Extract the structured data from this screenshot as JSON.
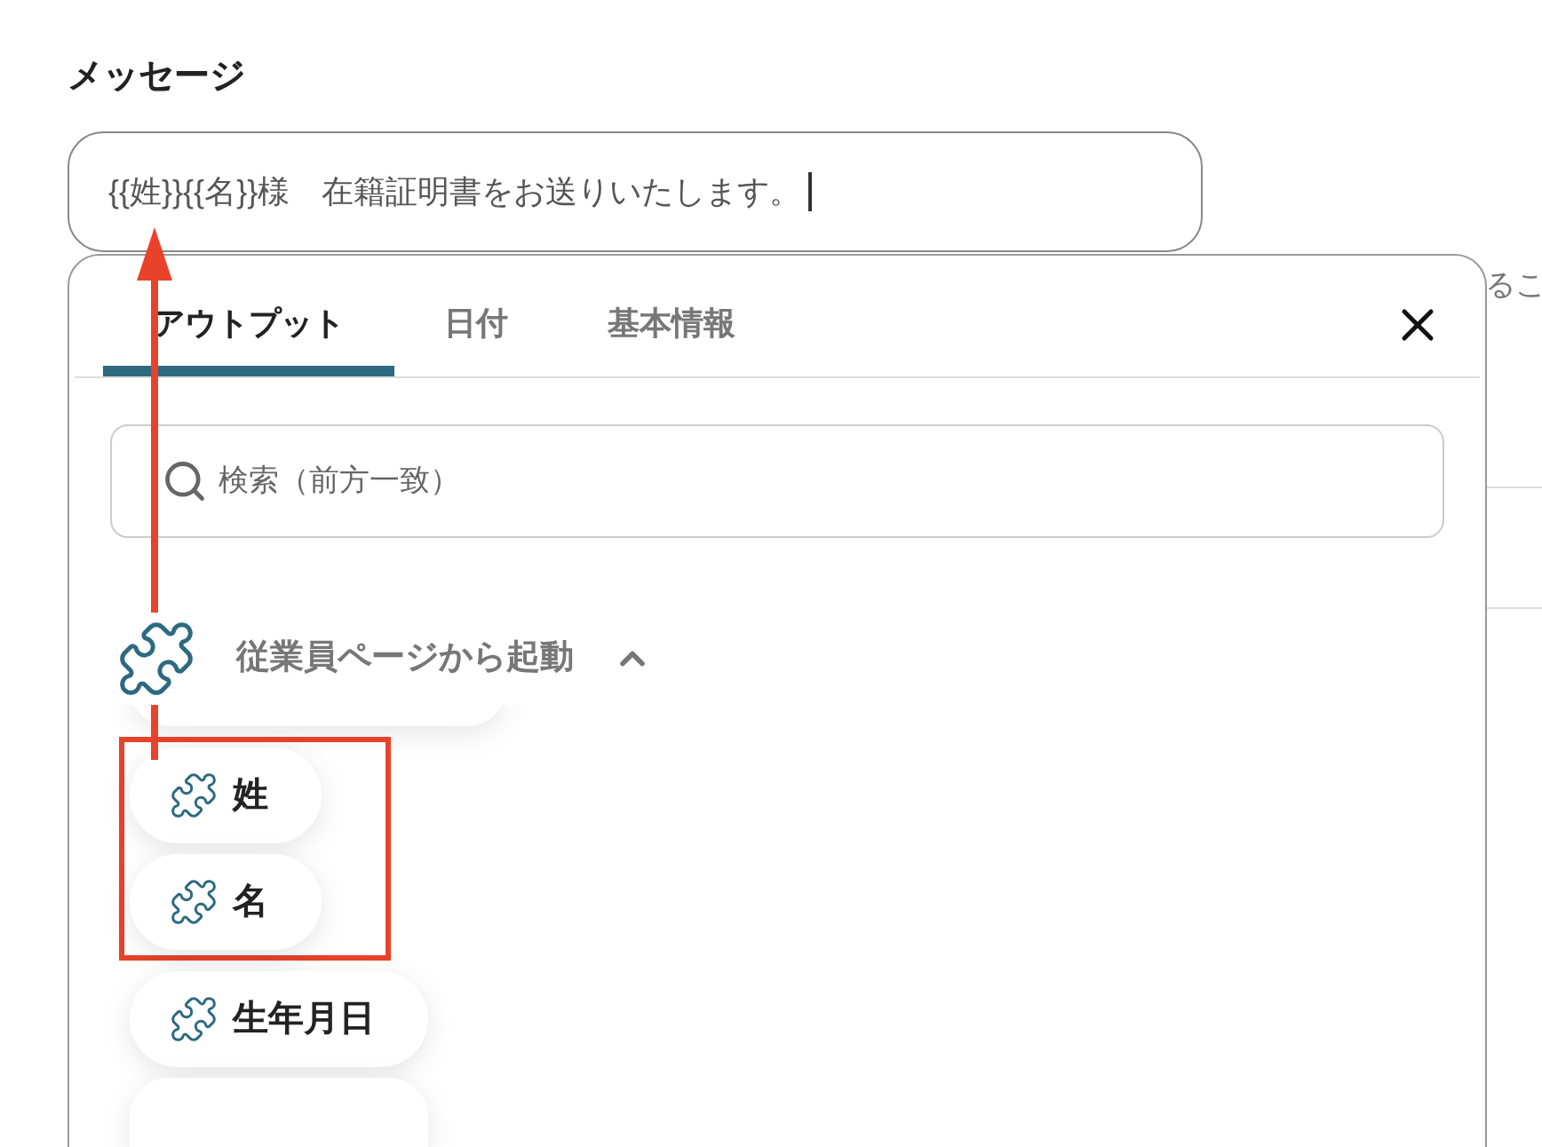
{
  "field": {
    "label": "メッセージ",
    "value": "{{姓}}{{名}}様　在籍証明書をお送りいたします。"
  },
  "background_text": "るこ",
  "popup": {
    "tabs": [
      {
        "label": "アウトプット",
        "selected": true
      },
      {
        "label": "日付",
        "selected": false
      },
      {
        "label": "基本情報",
        "selected": false
      }
    ],
    "search": {
      "placeholder": "検索（前方一致）"
    },
    "section": {
      "title": "従業員ページから起動",
      "expanded": true
    },
    "items": [
      {
        "label": "姓",
        "highlighted": true
      },
      {
        "label": "名",
        "highlighted": true
      },
      {
        "label": "生年月日",
        "highlighted": false
      }
    ]
  }
}
